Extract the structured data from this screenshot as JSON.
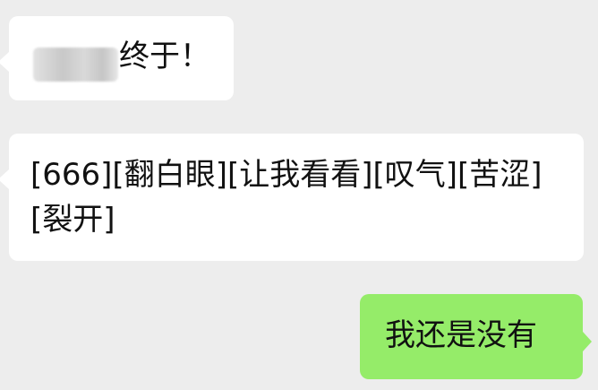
{
  "messages": [
    {
      "sender_blurred": true,
      "text": "终于！"
    },
    {
      "text": "[666][翻白眼][让我看看][叹气][苦涩][裂开]"
    },
    {
      "text": "我还是没有"
    }
  ],
  "colors": {
    "background": "#ededed",
    "incoming_bubble": "#ffffff",
    "outgoing_bubble": "#95ec69"
  }
}
